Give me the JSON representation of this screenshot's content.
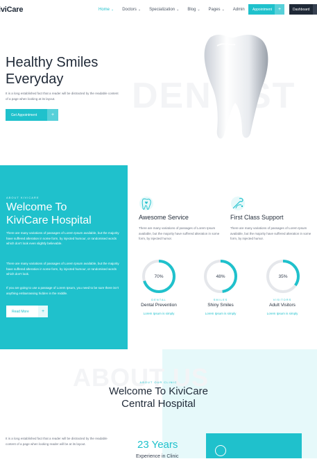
{
  "header": {
    "logo": "iviCare",
    "nav": [
      {
        "label": "Home",
        "active": true
      },
      {
        "label": "Doctors",
        "active": false
      },
      {
        "label": "Specialization",
        "active": false
      },
      {
        "label": "Blog",
        "active": false
      },
      {
        "label": "Pages",
        "active": false
      },
      {
        "label": "Admin",
        "active": false
      }
    ],
    "appointment_label": "Appointment",
    "dashboard_label": "Dashboard"
  },
  "hero": {
    "title_line1": "Healthy Smiles",
    "title_line2": "Everyday",
    "description": "It is a long established fact that a reader will be distracted by the readable content of a page when looking at its layout.",
    "cta_label": "Get Appointment",
    "watermark": "DENTIST"
  },
  "welcome": {
    "tag": "ABOUT KIVICARE",
    "title_line1": "Welcome To",
    "title_line2": "KiviCare Hospital",
    "paragraphs": [
      "There are many variations of passages of Lorem Ipsum available, but the majority have suffered alteration in some form, by injected humour, or randomised words which don't look even slightly believable.",
      "There are many variations of passages of Lorem Ipsum available, but the majority have suffered alteration in some form, by injected humour, or randomised words which don't look.",
      "If you are going to use a passage of Lorem Ipsum, you need to be sure there isn't anything embarrassing hidden in the middle."
    ],
    "read_more_label": "Read More"
  },
  "services": [
    {
      "icon": "tooth-heart-icon",
      "title": "Awesome Service",
      "desc": "There are many variations of passages of Lorem Ipsum available, but the majority have suffered alteration in some form, by injected humor."
    },
    {
      "icon": "dental-tools-icon",
      "title": "First Class Support",
      "desc": "There are many variations of passages of Lorem Ipsum available, but the majority have suffered alteration in some form, by injected humor."
    }
  ],
  "stats": [
    {
      "percent": 70,
      "percent_label": "70%",
      "tag": "DENTAL",
      "name": "Dental Prevention",
      "sub": "Lorem Ipsum is simply"
    },
    {
      "percent": 48,
      "percent_label": "48%",
      "tag": "SMILES",
      "name": "Shiny Smiles",
      "sub": "Lorem Ipsum is simply"
    },
    {
      "percent": 35,
      "percent_label": "35%",
      "tag": "VISITORS",
      "name": "Adult Visitors",
      "sub": "Lorem Ipsum is simply"
    }
  ],
  "about": {
    "watermark": "ABOUT US",
    "tag": "ABOUT OUR CLINIC",
    "title_line1": "Welcome To KiviCare",
    "title_line2": "Central Hospital",
    "description": "It is a long established fact that a reader will be distracted by the readable content of a page when looking reader will be at its layout.",
    "years": "23 Years",
    "years_sub": "Experience in Clinic"
  },
  "colors": {
    "accent": "#1fc1cc",
    "dark": "#1f2937"
  }
}
